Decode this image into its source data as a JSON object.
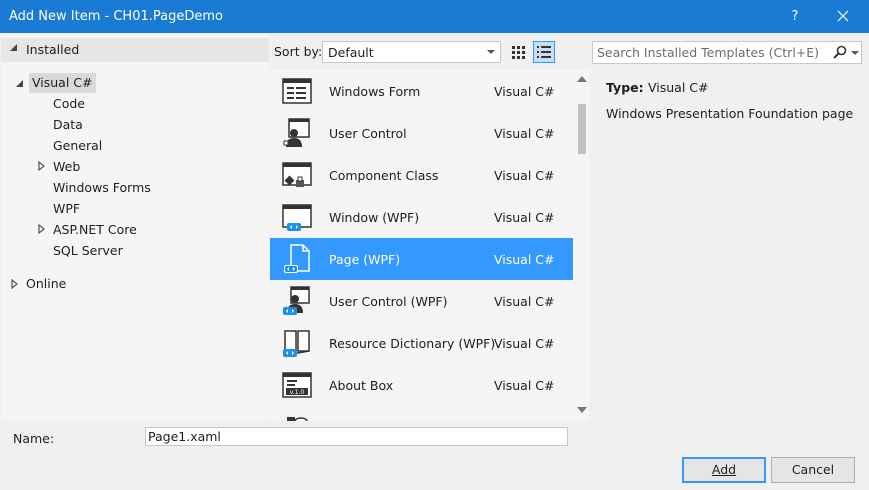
{
  "window": {
    "title": "Add New Item - CH01.PageDemo",
    "help_label": "?",
    "close_label": "close"
  },
  "tree": {
    "installed_label": "Installed",
    "visual_csharp": "Visual C#",
    "children": [
      "Code",
      "Data",
      "General",
      "Web",
      "Windows Forms",
      "WPF",
      "ASP.NET Core",
      "SQL Server"
    ],
    "online_label": "Online"
  },
  "sort": {
    "label": "Sort by:",
    "selected": "Default"
  },
  "search": {
    "placeholder": "Search Installed Templates (Ctrl+E)"
  },
  "templates": [
    {
      "name": "Windows Form",
      "lang": "Visual C#",
      "icon": "windows-form-icon"
    },
    {
      "name": "User Control",
      "lang": "Visual C#",
      "icon": "user-control-icon"
    },
    {
      "name": "Component Class",
      "lang": "Visual C#",
      "icon": "component-class-icon"
    },
    {
      "name": "Window (WPF)",
      "lang": "Visual C#",
      "icon": "wpf-window-icon"
    },
    {
      "name": "Page (WPF)",
      "lang": "Visual C#",
      "icon": "wpf-page-icon"
    },
    {
      "name": "User Control (WPF)",
      "lang": "Visual C#",
      "icon": "wpf-user-control-icon"
    },
    {
      "name": "Resource Dictionary (WPF)",
      "lang": "Visual C#",
      "icon": "resource-dictionary-icon"
    },
    {
      "name": "About Box",
      "lang": "Visual C#",
      "icon": "about-box-icon"
    }
  ],
  "selected_index": 4,
  "details": {
    "type_label": "Type:",
    "type_value": "Visual C#",
    "description": "Windows Presentation Foundation page"
  },
  "name_field": {
    "label": "Name:",
    "value": "Page1.xaml"
  },
  "buttons": {
    "add": "Add",
    "cancel": "Cancel"
  },
  "colors": {
    "title_bar": "#1a7bd4",
    "selection": "#3399ff",
    "wpf_badge": "#1e90e6"
  }
}
